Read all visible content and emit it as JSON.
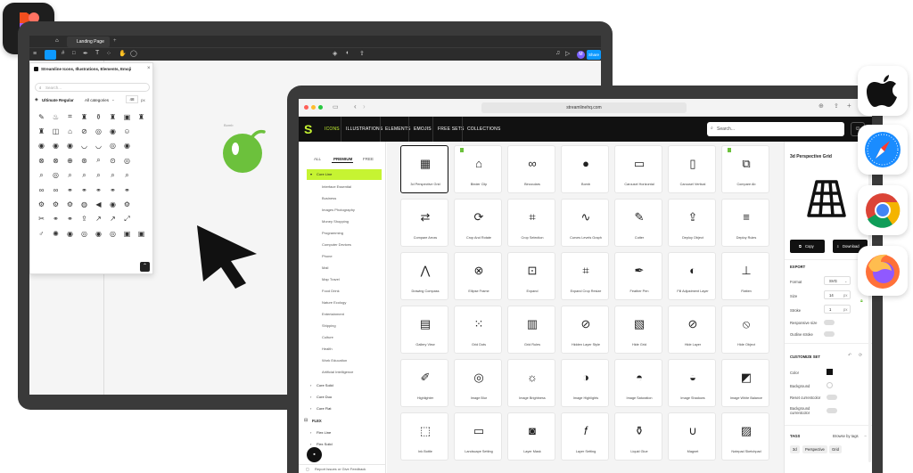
{
  "figma": {
    "app_icon": "figma-logo-icon",
    "tabs": {
      "active_tab": "Landing Page"
    },
    "toolbar": {
      "share_label": "Share",
      "avatar_initial": "M"
    },
    "plugin": {
      "title": "Streamline Icons, Illustrations, Elements, Emoji",
      "search_placeholder": "Search...",
      "style_select": "Ultimate Regular",
      "category_select": "All categories",
      "size_value": "48",
      "size_unit": "px"
    },
    "canvas_label": "Bomb"
  },
  "browser": {
    "url": "streamlinehq.com"
  },
  "streamline": {
    "nav": [
      "ICONS",
      "ILLUSTRATIONS",
      "ELEMENTS",
      "EMOJIS",
      "FREE SETS",
      "COLLECTIONS"
    ],
    "search_placeholder": "Search...",
    "filter_tabs": [
      "ALL",
      "PREMIUM",
      "FREE"
    ],
    "sidebar": {
      "active_set": "Core Line",
      "categories": [
        "Interface Essential",
        "Business",
        "Images Photography",
        "Money Shopping",
        "Programming",
        "Computer Devices",
        "Phone",
        "Mail",
        "Map Travel",
        "Food Drink",
        "Nature Ecology",
        "Entertainment",
        "Shipping",
        "Culture",
        "Health",
        "Work Education",
        "Artificial Intelligence"
      ],
      "other_sets": [
        "Core Solid",
        "Core Duo",
        "Core Flat"
      ],
      "flex_heading": "FLEX",
      "flex_sets": [
        "Flex Line",
        "Flex Solid"
      ],
      "report_link": "Report Issues or Give Feedback"
    },
    "icons": [
      {
        "name": "3d Perspective Grid",
        "glyph": "▦"
      },
      {
        "name": "Binder Clip",
        "glyph": "⌂"
      },
      {
        "name": "Binoculars",
        "glyph": "∞"
      },
      {
        "name": "Bomb",
        "glyph": "●"
      },
      {
        "name": "Carousel Horizontal",
        "glyph": "▭"
      },
      {
        "name": "Carousel Vertical",
        "glyph": "▯"
      },
      {
        "name": "Compare Ab",
        "glyph": "⧉"
      },
      {
        "name": "Compare Arrow",
        "glyph": "⇄"
      },
      {
        "name": "Crop And Rotate",
        "glyph": "⟳"
      },
      {
        "name": "Crop Selection",
        "glyph": "⌗"
      },
      {
        "name": "Curves Levels Graph",
        "glyph": "∿"
      },
      {
        "name": "Cutter",
        "glyph": "✎"
      },
      {
        "name": "Deploy Object",
        "glyph": "⇪"
      },
      {
        "name": "Deploy Rules",
        "glyph": "≡"
      },
      {
        "name": "Drawing Compass",
        "glyph": "⋀"
      },
      {
        "name": "Ellipse Frame",
        "glyph": "⊗"
      },
      {
        "name": "Expand",
        "glyph": "⊡"
      },
      {
        "name": "Expand Crop Resize",
        "glyph": "⌗"
      },
      {
        "name": "Feather Pen",
        "glyph": "✒"
      },
      {
        "name": "Fill Adjustment Layer",
        "glyph": "◐"
      },
      {
        "name": "Flatten",
        "glyph": "⊥"
      },
      {
        "name": "Gallery View",
        "glyph": "▤"
      },
      {
        "name": "Grid Dots",
        "glyph": "⁙"
      },
      {
        "name": "Grid Rules",
        "glyph": "▥"
      },
      {
        "name": "Hidden Layer Style",
        "glyph": "⊘"
      },
      {
        "name": "Hide Grid",
        "glyph": "▧"
      },
      {
        "name": "Hide Layer",
        "glyph": "⊘"
      },
      {
        "name": "Hide Object",
        "glyph": "⦸"
      },
      {
        "name": "Highlighter",
        "glyph": "✐"
      },
      {
        "name": "Image Blur",
        "glyph": "◎"
      },
      {
        "name": "Image Brightness",
        "glyph": "☼"
      },
      {
        "name": "Image Highlights",
        "glyph": "◑"
      },
      {
        "name": "Image Saturation",
        "glyph": "◓"
      },
      {
        "name": "Image Shadows",
        "glyph": "◒"
      },
      {
        "name": "Image White Balance",
        "glyph": "◩"
      },
      {
        "name": "Ink Bottle",
        "glyph": "⬚"
      },
      {
        "name": "Landscape Setting",
        "glyph": "▭"
      },
      {
        "name": "Layer Mask",
        "glyph": "◙"
      },
      {
        "name": "Layer Setting",
        "glyph": "𝑓"
      },
      {
        "name": "Liquid Glue",
        "glyph": "⚱"
      },
      {
        "name": "Magnet",
        "glyph": "∪"
      },
      {
        "name": "Notepad Sketchpad",
        "glyph": "▨"
      }
    ],
    "detail": {
      "title": "3d Perspective Grid",
      "copy_label": "Copy",
      "download_label": "Download",
      "export_heading": "EXPORT",
      "format_label": "Format",
      "format_value": "SVG",
      "size_label": "Size",
      "size_value": "14",
      "stroke_label": "Stroke",
      "stroke_value": "1",
      "unit": "px",
      "responsive_label": "Responsive size",
      "outline_label": "Outline stroke",
      "customize_heading": "CUSTOMIZE SET",
      "color_label": "Color",
      "background_label": "Background",
      "reset_label": "Reset currentcolor",
      "bg_current_label": "Background currentcolor",
      "tags_heading": "TAGS",
      "browse_tags": "Browse by tags",
      "tags": [
        "3d",
        "Perspective",
        "Grid"
      ]
    }
  },
  "dock": [
    "apple-logo-icon",
    "safari-icon",
    "chrome-icon",
    "firefox-icon"
  ]
}
